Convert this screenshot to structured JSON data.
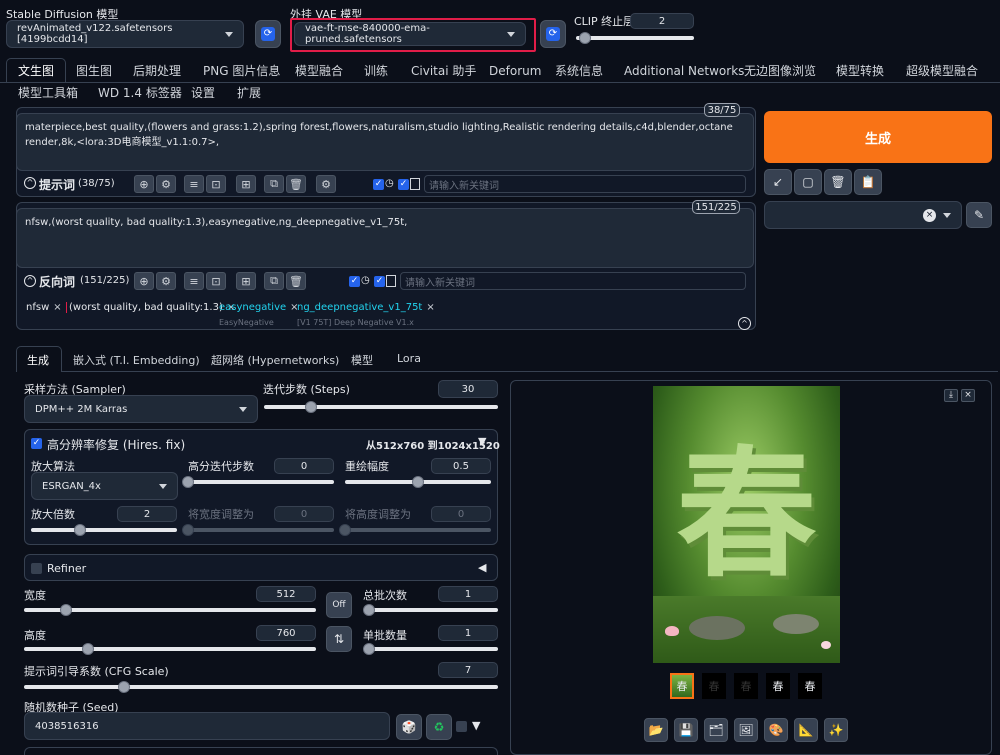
{
  "top": {
    "sd_model_label": "Stable Diffusion 模型",
    "sd_model_value": "revAnimated_v122.safetensors [4199bcdd14]",
    "vae_label": "外挂 VAE 模型",
    "vae_value": "vae-ft-mse-840000-ema-pruned.safetensors",
    "clip_label": "CLIP 终止层数",
    "clip_value": "2",
    "clip_fraction": 0.08
  },
  "tabs_row1": [
    "文生图",
    "图生图",
    "后期处理",
    "PNG 图片信息",
    "模型融合",
    "训练",
    "Civitai 助手",
    "Deforum",
    "系统信息",
    "Additional Networks",
    "无边图像浏览",
    "模型转换",
    "超级模型融合"
  ],
  "tabs_row2": [
    "模型工具箱",
    "WD 1.4 标签器",
    "设置",
    "扩展"
  ],
  "prompt": {
    "text": "materpiece,best quality,(flowers and grass:1.2),spring forest,flowers,naturalism,studio lighting,Realistic rendering details,c4d,blender,octane render,8k,<lora:3D电商模型_v1.1:0.7>,",
    "counter": "38/75",
    "label": "提示词",
    "count": "(38/75)",
    "keyword_placeholder": "请输入新关键词"
  },
  "negative": {
    "text": "nfsw,(worst quality, bad quality:1.3),easynegative,ng_deepnegative_v1_75t,",
    "counter": "151/225",
    "label": "反向词",
    "count": "(151/225)",
    "keyword_placeholder": "请输入新关键词",
    "tags": [
      {
        "text": "nfsw",
        "sub": ""
      },
      {
        "text": "(worst quality, bad quality:1.3)",
        "sub": ""
      },
      {
        "text": "easynegative",
        "sub": "EasyNegative"
      },
      {
        "text": "ng_deepnegative_v1_75t",
        "sub": "[V1 75T] Deep Negative V1.x"
      }
    ]
  },
  "right": {
    "generate": "生成"
  },
  "subtabs": [
    "生成",
    "嵌入式 (T.I. Embedding)",
    "超网络 (Hypernetworks)",
    "模型",
    "Lora"
  ],
  "settings": {
    "sampler_label": "采样方法 (Sampler)",
    "sampler_value": "DPM++ 2M Karras",
    "steps_label": "迭代步数 (Steps)",
    "steps_value": "30",
    "steps_fraction": 0.2,
    "hires_label": "高分辨率修复 (Hires. fix)",
    "hires_info": "从512x760 到1024x1520",
    "upscaler_label": "放大算法",
    "upscaler_value": "ESRGAN_4x",
    "hires_steps_label": "高分迭代步数",
    "hires_steps_value": "0",
    "hires_steps_fraction": 0,
    "denoise_label": "重绘幅度",
    "denoise_value": "0.5",
    "denoise_fraction": 0.5,
    "scale_label": "放大倍数",
    "scale_value": "2",
    "scale_fraction": 0.333,
    "resize_w_label": "将宽度调整为",
    "resize_w_value": "0",
    "resize_h_label": "将高度调整为",
    "resize_h_value": "0",
    "refiner_label": "Refiner",
    "width_label": "宽度",
    "width_value": "512",
    "width_fraction": 0.143,
    "height_label": "高度",
    "height_value": "760",
    "height_fraction": 0.218,
    "batch_count_label": "总批次数",
    "batch_count_value": "1",
    "batch_count_fraction": 0,
    "batch_size_label": "单批数量",
    "batch_size_value": "1",
    "batch_size_fraction": 0,
    "off_label": "Off",
    "cfg_label": "提示词引导系数 (CFG Scale)",
    "cfg_value": "7",
    "cfg_fraction": 0.21,
    "seed_label": "随机数种子 (Seed)",
    "seed_value": "4038516316"
  },
  "output": {
    "image_char": "春",
    "thumb_char": "春"
  },
  "colors": {
    "accent": "#f97316",
    "primary": "#2563eb",
    "vae_highlight": "#e11d48",
    "tag_cyan": "#22d3ee"
  }
}
